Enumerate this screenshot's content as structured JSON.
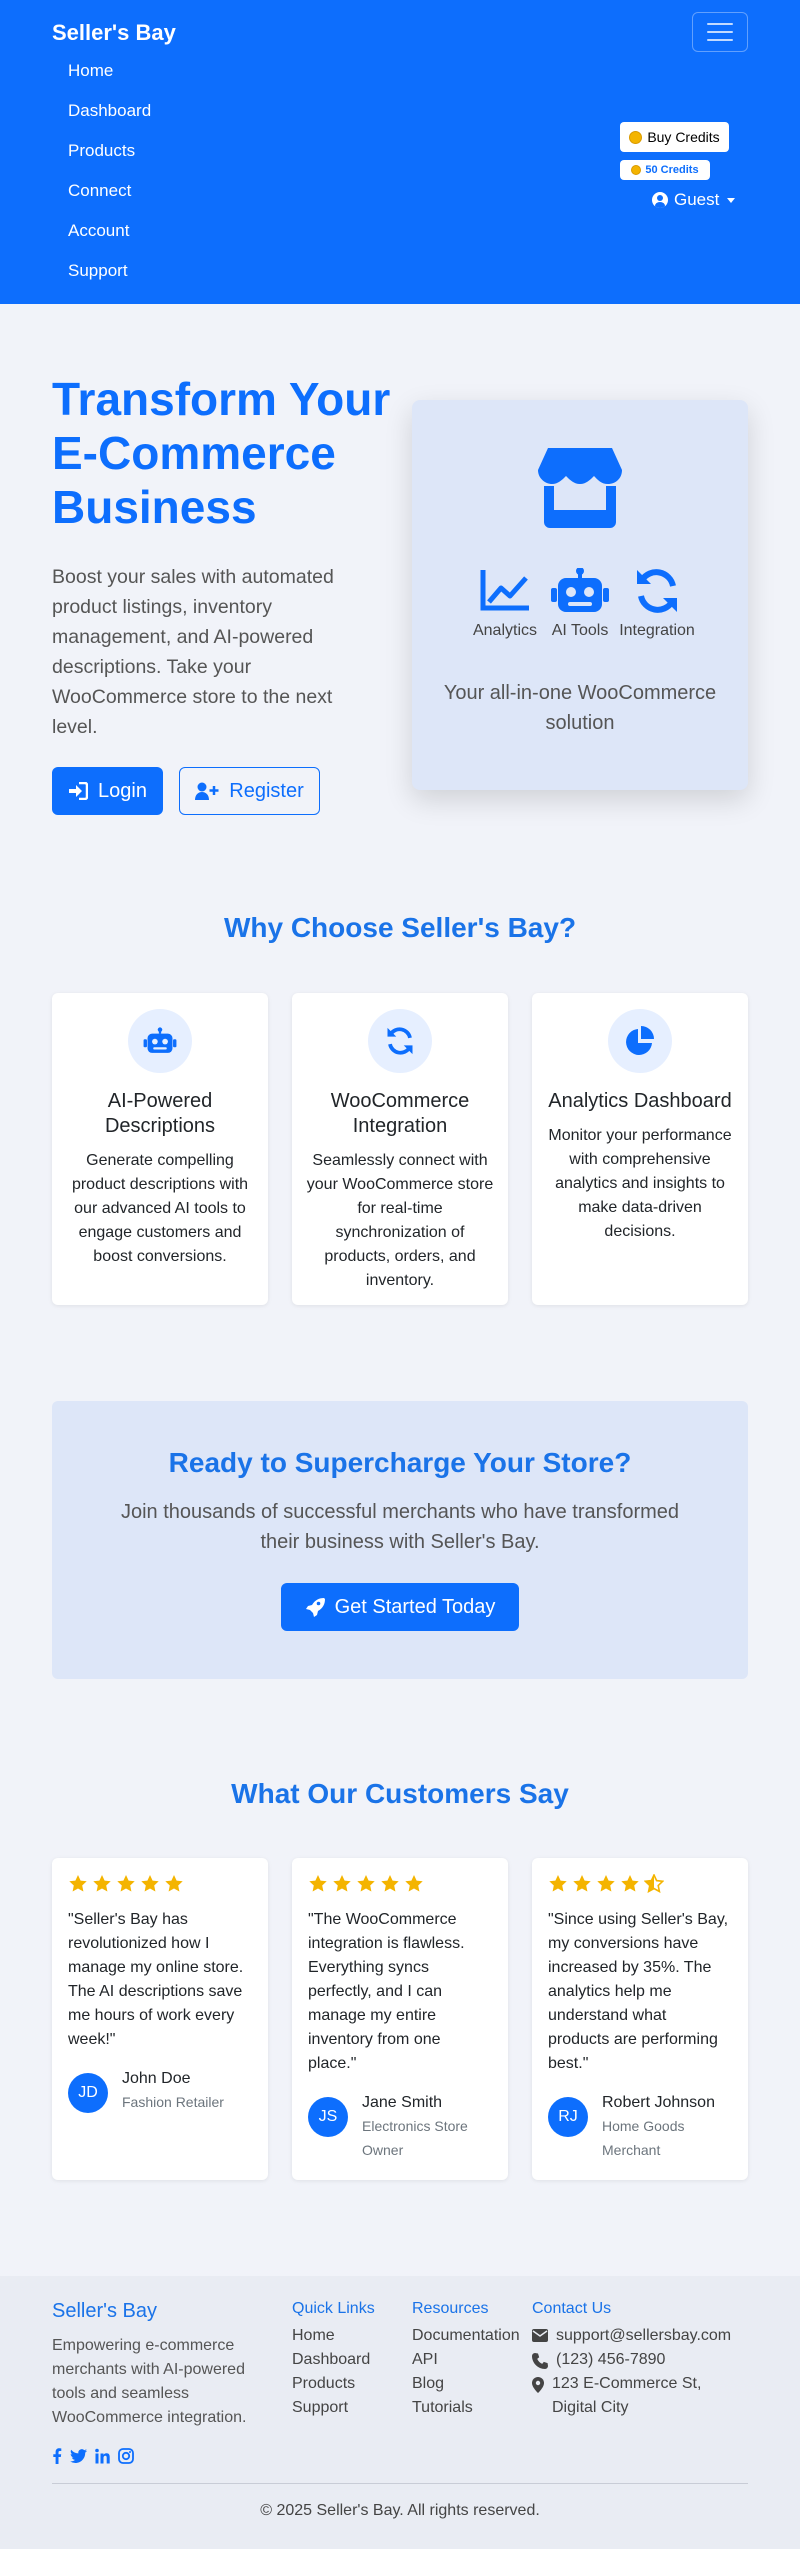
{
  "navbar": {
    "brand": "Seller's Bay",
    "links": [
      "Home",
      "Dashboard",
      "Products",
      "Connect",
      "Account",
      "Support"
    ],
    "buy_credits": "Buy Credits",
    "credits_badge": "50 Credits",
    "user_label": "Guest"
  },
  "hero": {
    "title": "Transform Your E-Commerce Business",
    "description": "Boost your sales with automated product listings, inventory management, and AI-powered descriptions. Take your WooCommerce store to the next level.",
    "login_label": "Login",
    "register_label": "Register",
    "card": {
      "features": [
        "Analytics",
        "AI Tools",
        "Integration"
      ],
      "tagline": "Your all-in-one WooCommerce solution"
    }
  },
  "why": {
    "title": "Why Choose Seller's Bay?",
    "cards": [
      {
        "icon": "robot-icon",
        "title": "AI-Powered Descriptions",
        "text": "Generate compelling product descriptions with our advanced AI tools to engage customers and boost conversions."
      },
      {
        "icon": "sync-icon",
        "title": "WooCommerce Integration",
        "text": "Seamlessly connect with your WooCommerce store for real-time synchronization of products, orders, and inventory."
      },
      {
        "icon": "pie-chart-icon",
        "title": "Analytics Dashboard",
        "text": "Monitor your performance with comprehensive analytics and insights to make data-driven decisions."
      }
    ]
  },
  "cta": {
    "title": "Ready to Supercharge Your Store?",
    "description": "Join thousands of successful merchants who have transformed their business with Seller's Bay.",
    "button": "Get Started Today"
  },
  "testimonials": {
    "title": "What Our Customers Say",
    "items": [
      {
        "rating": 5,
        "quote": "\"Seller's Bay has revolutionized how I manage my online store. The AI descriptions save me hours of work every week!\"",
        "initials": "JD",
        "name": "John Doe",
        "role": "Fashion Retailer"
      },
      {
        "rating": 5,
        "quote": "\"The WooCommerce integration is flawless. Everything syncs perfectly, and I can manage my entire inventory from one place.\"",
        "initials": "JS",
        "name": "Jane Smith",
        "role": "Electronics Store Owner"
      },
      {
        "rating": 4.5,
        "quote": "\"Since using Seller's Bay, my conversions have increased by 35%. The analytics help me understand what products are performing best.\"",
        "initials": "RJ",
        "name": "Robert Johnson",
        "role": "Home Goods Merchant"
      }
    ]
  },
  "footer": {
    "brand": "Seller's Bay",
    "description": "Empowering e-commerce merchants with AI-powered tools and seamless WooCommerce integration.",
    "social": [
      "facebook-icon",
      "twitter-icon",
      "linkedin-icon",
      "instagram-icon"
    ],
    "quick_links": {
      "title": "Quick Links",
      "items": [
        "Home",
        "Dashboard",
        "Products",
        "Support"
      ]
    },
    "resources": {
      "title": "Resources",
      "items": [
        "Documentation",
        "API",
        "Blog",
        "Tutorials"
      ]
    },
    "contact": {
      "title": "Contact Us",
      "email": "support@sellersbay.com",
      "phone": "(123) 456-7890",
      "address": "123 E-Commerce St, Digital City"
    },
    "copyright": "© 2025 Seller's Bay. All rights reserved."
  },
  "colors": {
    "primary": "#0d6efd",
    "heading_blue": "#1a73e8",
    "star": "#f4b400",
    "card_tint": "#dde6f8"
  }
}
